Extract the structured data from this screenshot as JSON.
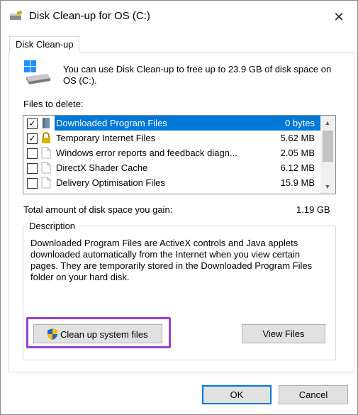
{
  "window": {
    "title": "Disk Clean-up for OS (C:)",
    "close_glyph": "✕"
  },
  "tabs": [
    {
      "label": "Disk Clean-up",
      "active": true
    }
  ],
  "intro": {
    "text": "You can use Disk Clean-up to free up to 23.9 GB of disk space on OS (C:)."
  },
  "files": {
    "label": "Files to delete:",
    "items": [
      {
        "name": "Downloaded Program Files",
        "size": "0 bytes",
        "checked": true,
        "selected": true,
        "icon": "folder-icon"
      },
      {
        "name": "Temporary Internet Files",
        "size": "5.62 MB",
        "checked": true,
        "selected": false,
        "icon": "lock-icon"
      },
      {
        "name": "Windows error reports and feedback diagn...",
        "size": "2.05 MB",
        "checked": false,
        "selected": false,
        "icon": "document-icon"
      },
      {
        "name": "DirectX Shader Cache",
        "size": "6.12 MB",
        "checked": false,
        "selected": false,
        "icon": "document-icon"
      },
      {
        "name": "Delivery Optimisation Files",
        "size": "15.9 MB",
        "checked": false,
        "selected": false,
        "icon": "document-icon"
      }
    ],
    "check_glyph": "✓"
  },
  "total": {
    "label": "Total amount of disk space you gain:",
    "value": "1.19 GB"
  },
  "description": {
    "label": "Description",
    "text": "Downloaded Program Files are ActiveX controls and Java applets downloaded automatically from the Internet when you view certain pages. They are temporarily stored in the Downloaded Program Files folder on your hard disk."
  },
  "buttons": {
    "cleanup_system": "Clean up system files",
    "view_files": "View Files",
    "ok": "OK",
    "cancel": "Cancel"
  },
  "colors": {
    "selection": "#0078d7",
    "highlight_frame": "#9b3fd9",
    "ok_border": "#0078d7"
  }
}
